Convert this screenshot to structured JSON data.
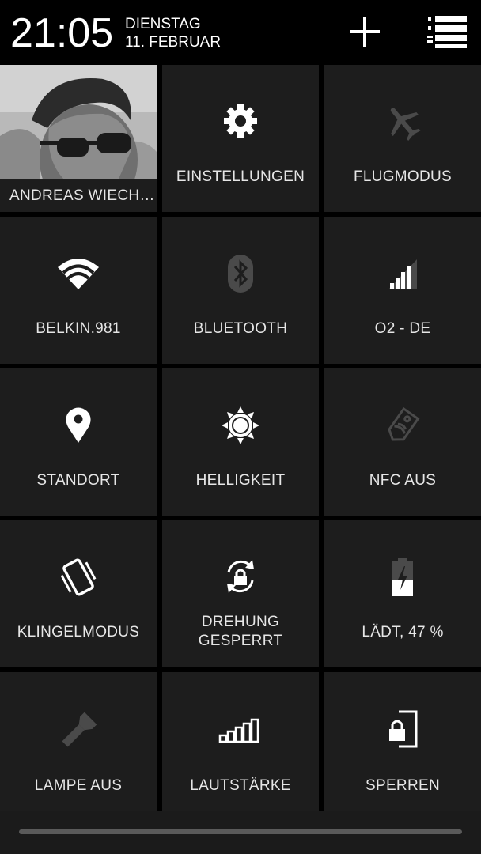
{
  "status_bar": {
    "time": "21:05",
    "weekday": "DIENSTAG",
    "date": "11. FEBRUAR"
  },
  "tiles": [
    {
      "label": "ANDREAS WIECH…",
      "icon": "profile-photo",
      "active": true
    },
    {
      "label": "EINSTELLUNGEN",
      "icon": "gear-icon",
      "active": true
    },
    {
      "label": "FLUGMODUS",
      "icon": "airplane-icon",
      "active": false
    },
    {
      "label": "BELKIN.981",
      "icon": "wifi-icon",
      "active": true
    },
    {
      "label": "BLUETOOTH",
      "icon": "bluetooth-icon",
      "active": false
    },
    {
      "label": "O2 - DE",
      "icon": "signal-icon",
      "active": true
    },
    {
      "label": "STANDORT",
      "icon": "location-pin-icon",
      "active": true
    },
    {
      "label": "HELLIGKEIT",
      "icon": "brightness-icon",
      "active": true
    },
    {
      "label": "NFC AUS",
      "icon": "nfc-tag-icon",
      "active": false
    },
    {
      "label": "KLINGELMODUS",
      "icon": "vibrate-icon",
      "active": true
    },
    {
      "label": "DREHUNG\nGESPERRT",
      "icon": "rotation-lock-icon",
      "active": true
    },
    {
      "label": "LÄDT, 47 %",
      "icon": "battery-charging-icon",
      "active": true,
      "level_percent": 47
    },
    {
      "label": "LAMPE AUS",
      "icon": "flashlight-icon",
      "active": false
    },
    {
      "label": "LAUTSTÄRKE",
      "icon": "volume-bars-icon",
      "active": true
    },
    {
      "label": "SPERREN",
      "icon": "lock-screen-icon",
      "active": true
    }
  ],
  "colors": {
    "background": "#000000",
    "tile": "#1d1d1d",
    "text": "#e6e6e6",
    "icon_active": "#ffffff",
    "icon_inactive": "#4a4a4a"
  }
}
